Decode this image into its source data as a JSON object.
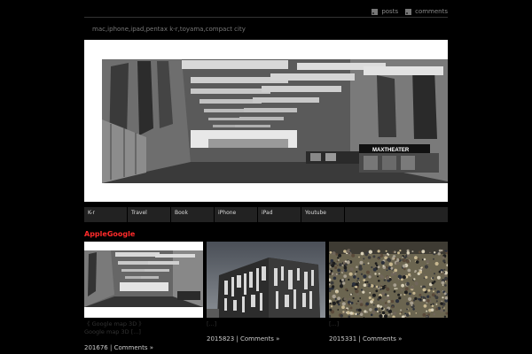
{
  "header": {
    "feeds": [
      {
        "label": "posts",
        "icon": "rss-icon"
      },
      {
        "label": "comments",
        "icon": "rss-icon"
      }
    ],
    "tagline": "mac,iphone,ipad,pentax k-r,toyama,compact city"
  },
  "nav": {
    "items": [
      "K-r",
      "Travel",
      "Book",
      "iPhone",
      "iPad",
      "Youtube"
    ]
  },
  "hero": {
    "sign_text": "MAXTHEATER"
  },
  "section": {
    "title": "AppleGoogle"
  },
  "posts": [
    {
      "excerpt_line1": "《 Google map 3D 》",
      "excerpt_line2": "Google map 3D [...]",
      "date": "201676",
      "separator": "|",
      "comments": "Comments »"
    },
    {
      "excerpt_line1": "[...]",
      "date": "2015823",
      "separator": "|",
      "comments": "Comments »"
    },
    {
      "excerpt_line1": "[...]",
      "date": "2015331",
      "separator": "|",
      "comments": "Comments »"
    }
  ],
  "colors": {
    "background": "#000000",
    "accent": "#ff2a2a",
    "nav": "#222222"
  }
}
